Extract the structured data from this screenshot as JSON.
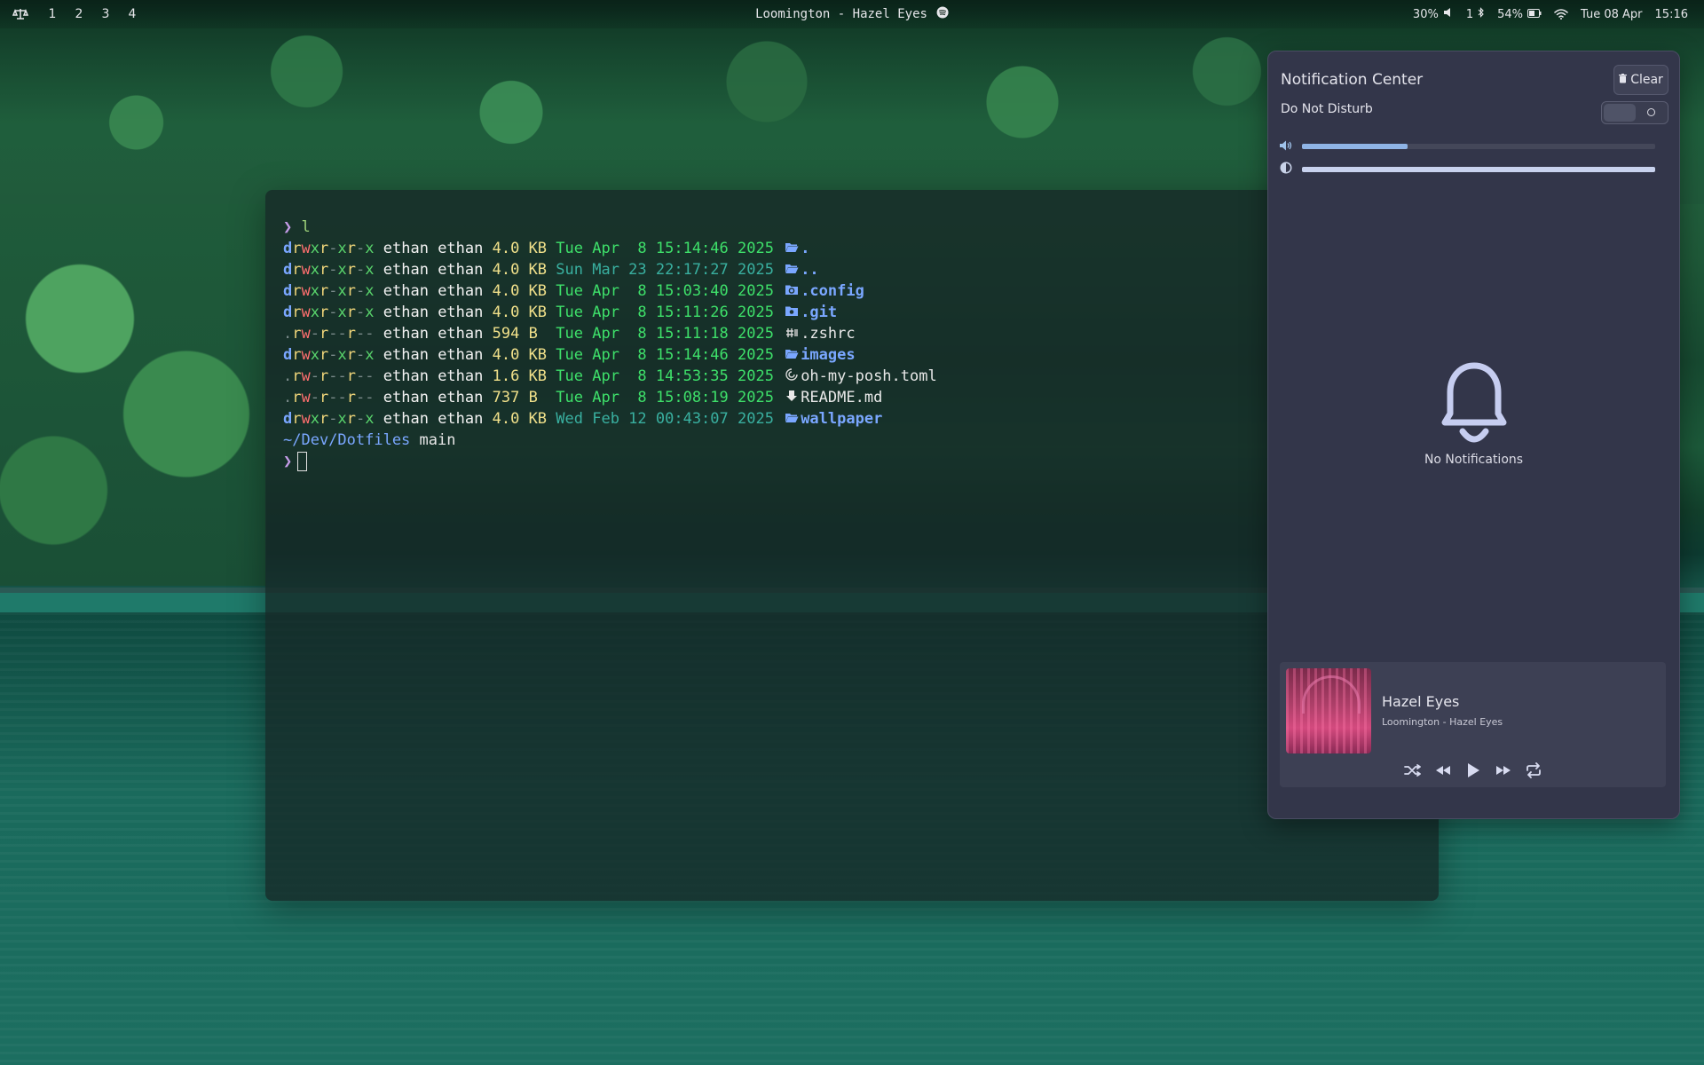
{
  "topbar": {
    "logo_icon": "scales-icon",
    "workspaces": [
      "1",
      "2",
      "3",
      "4"
    ],
    "now_playing": "Loomington - Hazel Eyes",
    "now_playing_icon": "spotify-icon",
    "volume": "30%",
    "bluetooth_count": "1",
    "battery": "54%",
    "date": "Tue 08 Apr",
    "time": "15:16"
  },
  "terminal": {
    "command_prompt": "❯",
    "command": "l",
    "entries": [
      {
        "perm_type": "d",
        "perm": [
          "r",
          "w",
          "x",
          "r",
          "-",
          "x",
          "r",
          "-",
          "x"
        ],
        "user": "ethan",
        "group": "ethan",
        "size": "4.0 KB",
        "date": "Tue Apr  8 15:14:46 2025",
        "date_old": false,
        "icon": "folder-open-icon",
        "name": ".",
        "is_dir": true
      },
      {
        "perm_type": "d",
        "perm": [
          "r",
          "w",
          "x",
          "r",
          "-",
          "x",
          "r",
          "-",
          "x"
        ],
        "user": "ethan",
        "group": "ethan",
        "size": "4.0 KB",
        "date": "Sun Mar 23 22:17:27 2025",
        "date_old": true,
        "icon": "folder-open-icon",
        "name": "..",
        "is_dir": true
      },
      {
        "perm_type": "d",
        "perm": [
          "r",
          "w",
          "x",
          "r",
          "-",
          "x",
          "r",
          "-",
          "x"
        ],
        "user": "ethan",
        "group": "ethan",
        "size": "4.0 KB",
        "date": "Tue Apr  8 15:03:40 2025",
        "date_old": false,
        "icon": "config-folder-icon",
        "name": ".config",
        "is_dir": true
      },
      {
        "perm_type": "d",
        "perm": [
          "r",
          "w",
          "x",
          "r",
          "-",
          "x",
          "r",
          "-",
          "x"
        ],
        "user": "ethan",
        "group": "ethan",
        "size": "4.0 KB",
        "date": "Tue Apr  8 15:11:26 2025",
        "date_old": false,
        "icon": "git-folder-icon",
        "name": ".git",
        "is_dir": true
      },
      {
        "perm_type": ".",
        "perm": [
          "r",
          "w",
          "-",
          "r",
          "-",
          "-",
          "r",
          "-",
          "-"
        ],
        "user": "ethan",
        "group": "ethan",
        "size": "594 B ",
        "date": "Tue Apr  8 15:11:18 2025",
        "date_old": false,
        "icon": "shell-file-icon",
        "name": ".zshrc",
        "is_dir": false
      },
      {
        "perm_type": "d",
        "perm": [
          "r",
          "w",
          "x",
          "r",
          "-",
          "x",
          "r",
          "-",
          "x"
        ],
        "user": "ethan",
        "group": "ethan",
        "size": "4.0 KB",
        "date": "Tue Apr  8 15:14:46 2025",
        "date_old": false,
        "icon": "folder-open-icon",
        "name": "images",
        "is_dir": true
      },
      {
        "perm_type": ".",
        "perm": [
          "r",
          "w",
          "-",
          "r",
          "-",
          "-",
          "r",
          "-",
          "-"
        ],
        "user": "ethan",
        "group": "ethan",
        "size": "1.6 KB",
        "date": "Tue Apr  8 14:53:35 2025",
        "date_old": false,
        "icon": "toml-file-icon",
        "name": "oh-my-posh.toml",
        "is_dir": false
      },
      {
        "perm_type": ".",
        "perm": [
          "r",
          "w",
          "-",
          "r",
          "-",
          "-",
          "r",
          "-",
          "-"
        ],
        "user": "ethan",
        "group": "ethan",
        "size": "737 B ",
        "date": "Tue Apr  8 15:08:19 2025",
        "date_old": false,
        "icon": "markdown-file-icon",
        "name": "README.md",
        "is_dir": false
      },
      {
        "perm_type": "d",
        "perm": [
          "r",
          "w",
          "x",
          "r",
          "-",
          "x",
          "r",
          "-",
          "x"
        ],
        "user": "ethan",
        "group": "ethan",
        "size": "4.0 KB",
        "date": "Wed Feb 12 00:43:07 2025",
        "date_old": true,
        "icon": "folder-open-icon",
        "name": "wallpaper",
        "is_dir": true
      }
    ],
    "cwd": "~/Dev/Dotfiles",
    "branch": "main",
    "prompt": "❯"
  },
  "notification_center": {
    "title": "Notification Center",
    "clear_label": "Clear",
    "clear_icon": "trash-icon",
    "dnd_label": "Do Not Disturb",
    "dnd_enabled": false,
    "volume_level": 0.3,
    "brightness_level": 1.0,
    "empty_icon": "bell-icon",
    "empty_text": "No Notifications",
    "player": {
      "title": "Hazel Eyes",
      "artist": "Loomington - Hazel Eyes",
      "controls": [
        "shuffle-icon",
        "previous-icon",
        "play-icon",
        "next-icon",
        "repeat-icon"
      ]
    }
  },
  "colors": {
    "accent": "#8fb4e6",
    "panel_bg": "#33364a",
    "terminal_dir": "#7aa7ff",
    "terminal_date": "#3ee06a"
  }
}
